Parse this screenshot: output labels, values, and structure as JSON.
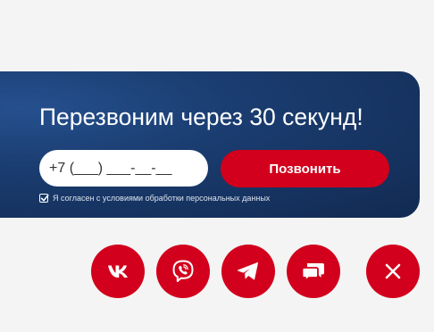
{
  "callback": {
    "title": "Перезвоним через 30 секунд!",
    "phone_placeholder": "+7 (___) ___-__-__",
    "phone_value": "",
    "call_button_label": "Позвонить",
    "consent_label": "Я согласен с условиями обработки персональных данных",
    "consent_checked": true
  },
  "social": [
    {
      "name": "vk",
      "icon": "vk-icon"
    },
    {
      "name": "viber",
      "icon": "viber-icon"
    },
    {
      "name": "telegram",
      "icon": "telegram-icon"
    },
    {
      "name": "chat",
      "icon": "chat-bubbles-icon"
    }
  ],
  "close": {
    "icon": "close-icon"
  },
  "colors": {
    "page_background": "#f4f4f4",
    "panel_background": "#1a3c6f",
    "accent_red": "#d2001c",
    "text_white": "#ffffff"
  }
}
